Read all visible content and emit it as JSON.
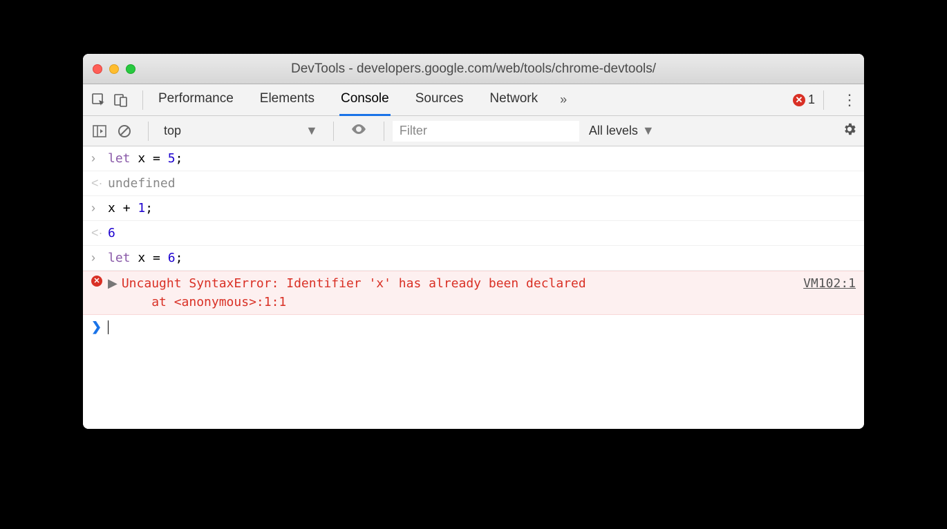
{
  "window": {
    "title": "DevTools - developers.google.com/web/tools/chrome-devtools/"
  },
  "tabbar": {
    "tabs": [
      "Performance",
      "Elements",
      "Console",
      "Sources",
      "Network"
    ],
    "active": "Console",
    "overflow_glyph": "»",
    "error_count": "1",
    "error_x": "✕"
  },
  "toolbar": {
    "context": "top",
    "caret": "▼",
    "filter_placeholder": "Filter",
    "levels_label": "All levels",
    "levels_caret": "▼"
  },
  "console": {
    "lines": [
      {
        "kind": "input",
        "tokens": [
          [
            "kw",
            "let"
          ],
          [
            "sp",
            " "
          ],
          [
            "var",
            "x"
          ],
          [
            "sp",
            " "
          ],
          [
            "op",
            "="
          ],
          [
            "sp",
            " "
          ],
          [
            "num",
            "5"
          ],
          [
            "op",
            ";"
          ]
        ]
      },
      {
        "kind": "output",
        "tokens": [
          [
            "undef",
            "undefined"
          ]
        ]
      },
      {
        "kind": "input",
        "tokens": [
          [
            "var",
            "x"
          ],
          [
            "sp",
            " "
          ],
          [
            "op",
            "+"
          ],
          [
            "sp",
            " "
          ],
          [
            "num",
            "1"
          ],
          [
            "op",
            ";"
          ]
        ]
      },
      {
        "kind": "output",
        "tokens": [
          [
            "result-num",
            "6"
          ]
        ]
      },
      {
        "kind": "input",
        "tokens": [
          [
            "kw",
            "let"
          ],
          [
            "sp",
            " "
          ],
          [
            "var",
            "x"
          ],
          [
            "sp",
            " "
          ],
          [
            "op",
            "="
          ],
          [
            "sp",
            " "
          ],
          [
            "num",
            "6"
          ],
          [
            "op",
            ";"
          ]
        ]
      }
    ],
    "error": {
      "message": "Uncaught SyntaxError: Identifier 'x' has already been declared",
      "stack": "    at <anonymous>:1:1",
      "source": "VM102:1",
      "expand_glyph": "▶"
    },
    "prompt_glyph": "❯"
  }
}
